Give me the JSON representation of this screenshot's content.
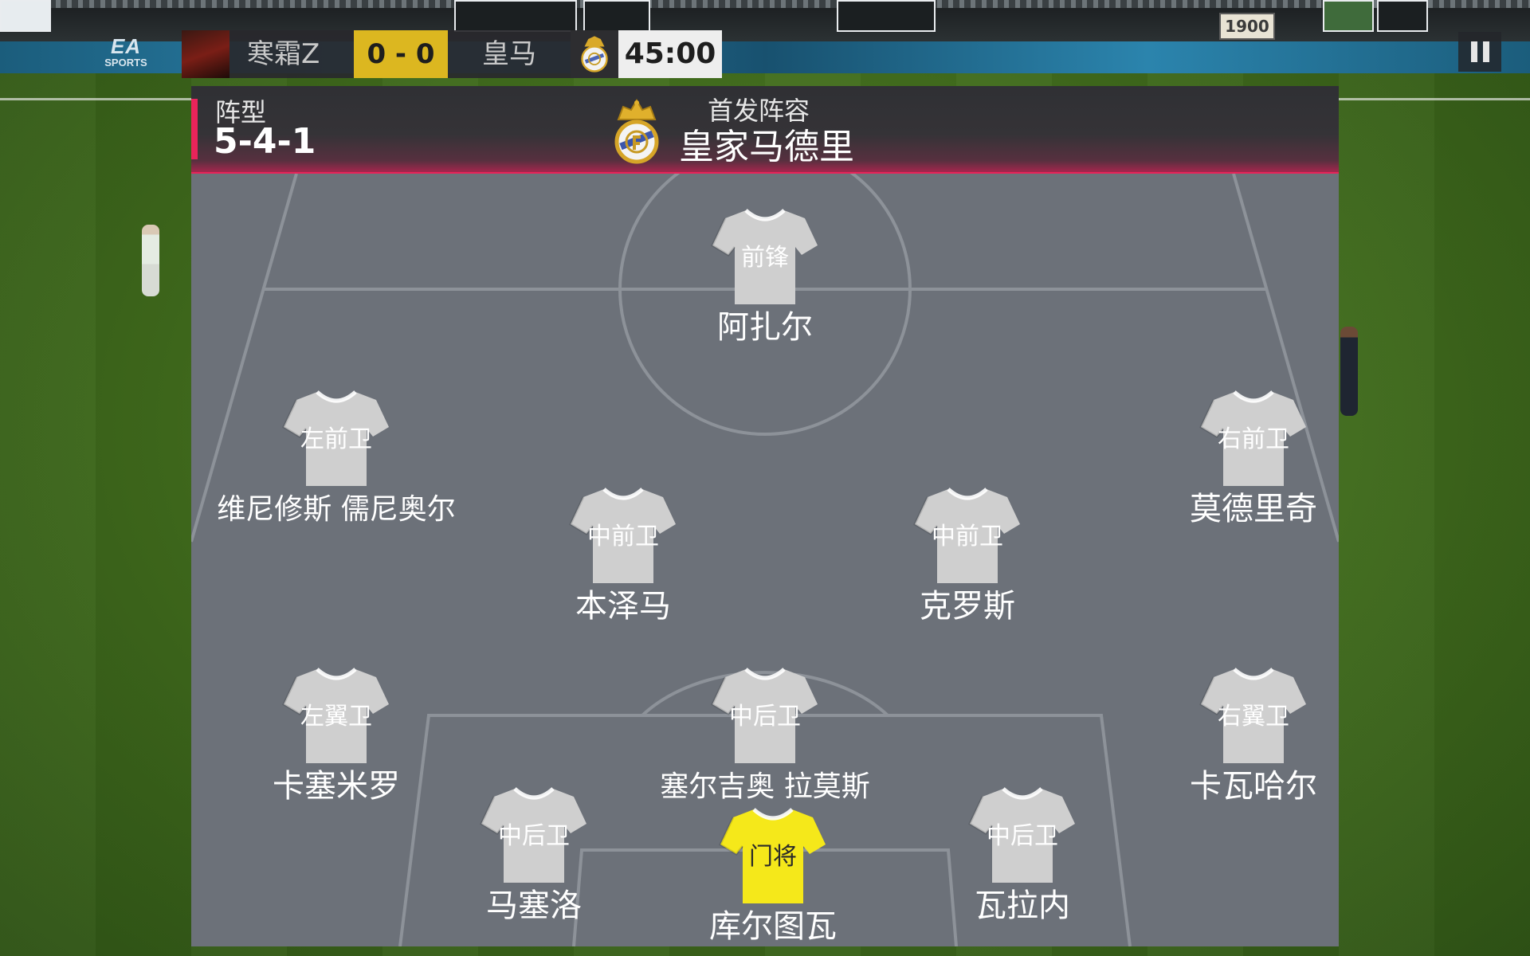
{
  "scoreboard": {
    "home_team": "寒霜Z",
    "score": "0 - 0",
    "away_team": "皇马",
    "timer": "45:00"
  },
  "background": {
    "sign_year": "1900",
    "brand_ea": "EA",
    "brand_sports": "SPORTS"
  },
  "panel": {
    "formation_label": "阵型",
    "formation_value": "5-4-1",
    "lineup_title": "首发阵容",
    "team_name": "皇家马德里"
  },
  "players": [
    {
      "position": "前锋",
      "name": "阿扎尔"
    },
    {
      "position": "左前卫",
      "name": "维尼修斯 儒尼奥尔"
    },
    {
      "position": "右前卫",
      "name": "莫德里奇"
    },
    {
      "position": "中前卫",
      "name": "本泽马"
    },
    {
      "position": "中前卫",
      "name": "克罗斯"
    },
    {
      "position": "左翼卫",
      "name": "卡塞米罗"
    },
    {
      "position": "中后卫",
      "name": "塞尔吉奥 拉莫斯"
    },
    {
      "position": "右翼卫",
      "name": "卡瓦哈尔"
    },
    {
      "position": "中后卫",
      "name": "马塞洛"
    },
    {
      "position": "中后卫",
      "name": "瓦拉内"
    },
    {
      "position": "门将",
      "name": "库尔图瓦"
    }
  ],
  "colors": {
    "accent": "#e9245a",
    "score_bg": "#dcb720",
    "panel_bg": "#6c7179",
    "outfield_jersey": "#cfcfcf",
    "goalkeeper_jersey": "#f5e81a"
  },
  "icons": {
    "pause": "pause-icon",
    "crest": "real-madrid-crest-icon",
    "jersey": "jersey-icon"
  }
}
